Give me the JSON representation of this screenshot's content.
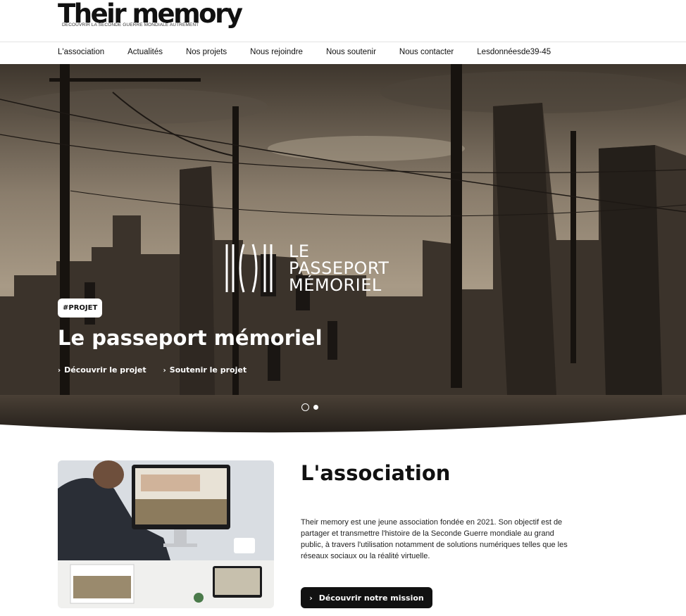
{
  "header": {
    "logo_title": "Their memory",
    "logo_subtitle": "DÉCOUVRIR LA SECONDE GUERRE MONDIALE AUTREMENT"
  },
  "nav": {
    "items": [
      {
        "label": "L'association"
      },
      {
        "label": "Actualités"
      },
      {
        "label": "Nos projets"
      },
      {
        "label": "Nous rejoindre"
      },
      {
        "label": "Nous soutenir"
      },
      {
        "label": "Nous contacter"
      },
      {
        "label": "Lesdonnéesde39-45"
      }
    ]
  },
  "hero": {
    "logo_lines": [
      "LE",
      "PASSEPORT",
      "MÉMORIEL"
    ],
    "tag": "#PROJET",
    "title": "Le passeport mémoriel",
    "links": [
      {
        "label": "Découvrir le projet",
        "icon": "chevron-right-icon"
      },
      {
        "label": "Soutenir le projet",
        "icon": "chevron-right-icon"
      }
    ],
    "slides_count": 2,
    "active_slide": 1
  },
  "association": {
    "title": "L'association",
    "text": "Their memory est une jeune association fondée en 2021. Son objectif est de partager et transmettre l'histoire de la Seconde Guerre mondiale au grand public, à travers l'utilisation notamment de solutions numériques telles que les réseaux sociaux ou la réalité virtuelle.",
    "cta_label": "Découvrir notre mission",
    "cta_icon": "chevron-right-icon"
  },
  "colors": {
    "accent": "#111111",
    "hero_tone": "#6b5c4a"
  }
}
